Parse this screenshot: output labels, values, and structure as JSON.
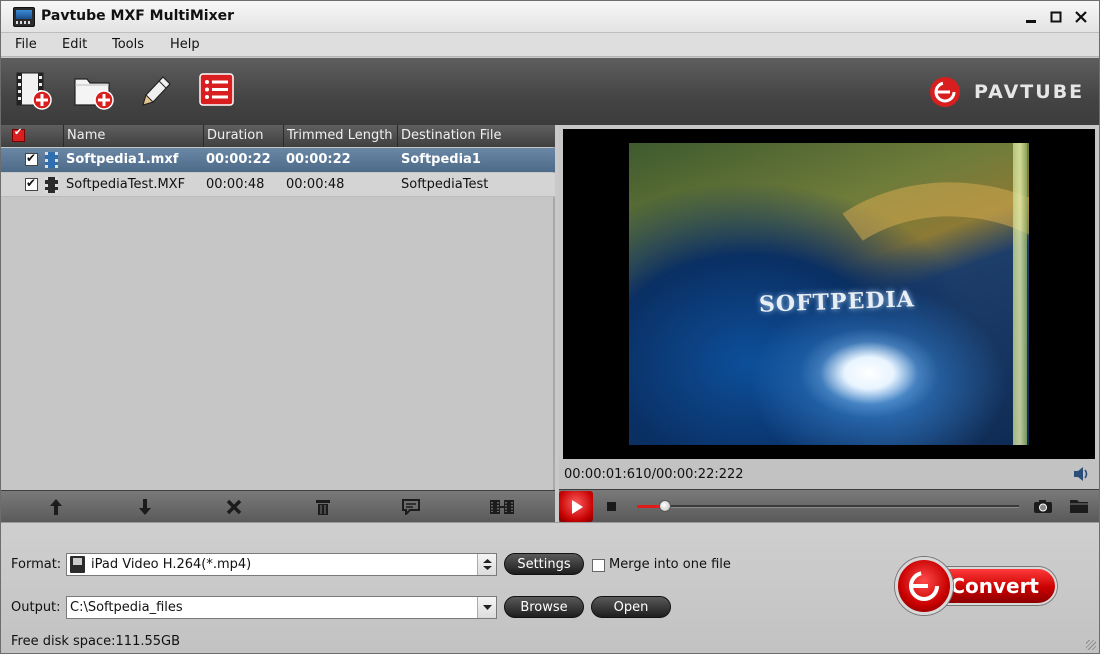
{
  "window": {
    "title": "Pavtube MXF MultiMixer",
    "controls": {
      "minimize": "▁",
      "maximize": "▢",
      "close": "✕"
    }
  },
  "menu": [
    "File",
    "Edit",
    "Tools",
    "Help"
  ],
  "toolbar": {
    "buttons": [
      "add-video-icon",
      "add-folder-icon",
      "edit-pencil-icon",
      "task-list-icon"
    ],
    "logo_text": "PAVTUBE",
    "accent": "#d81e1e"
  },
  "filelist": {
    "columns": [
      "Name",
      "Duration",
      "Trimmed Length",
      "Destination File"
    ],
    "rows": [
      {
        "name": "Softpedia1.mxf",
        "duration": "00:00:22",
        "trimmed": "00:00:22",
        "destination": "Softpedia1",
        "checked": true,
        "selected": true
      },
      {
        "name": "SoftpediaTest.MXF",
        "duration": "00:00:48",
        "trimmed": "00:00:48",
        "destination": "SoftpediaTest",
        "checked": true,
        "selected": false
      }
    ],
    "tools": [
      "move-up-icon",
      "move-down-icon",
      "remove-icon",
      "trash-icon",
      "subtitle-icon",
      "merge-icon"
    ]
  },
  "preview": {
    "overlay_text": "SOFTPEDIA",
    "time": "00:00:01:610/00:00:22:222",
    "progress": 0.073
  },
  "output": {
    "format_label": "Format:",
    "format_value": "iPad Video H.264(*.mp4)",
    "settings_label": "Settings",
    "merge_label": "Merge into one file",
    "merge_checked": false,
    "output_label": "Output:",
    "output_value": "C:\\Softpedia_files",
    "browse_label": "Browse",
    "open_label": "Open",
    "disk_space": "Free disk space:111.55GB",
    "convert_label": "Convert"
  }
}
